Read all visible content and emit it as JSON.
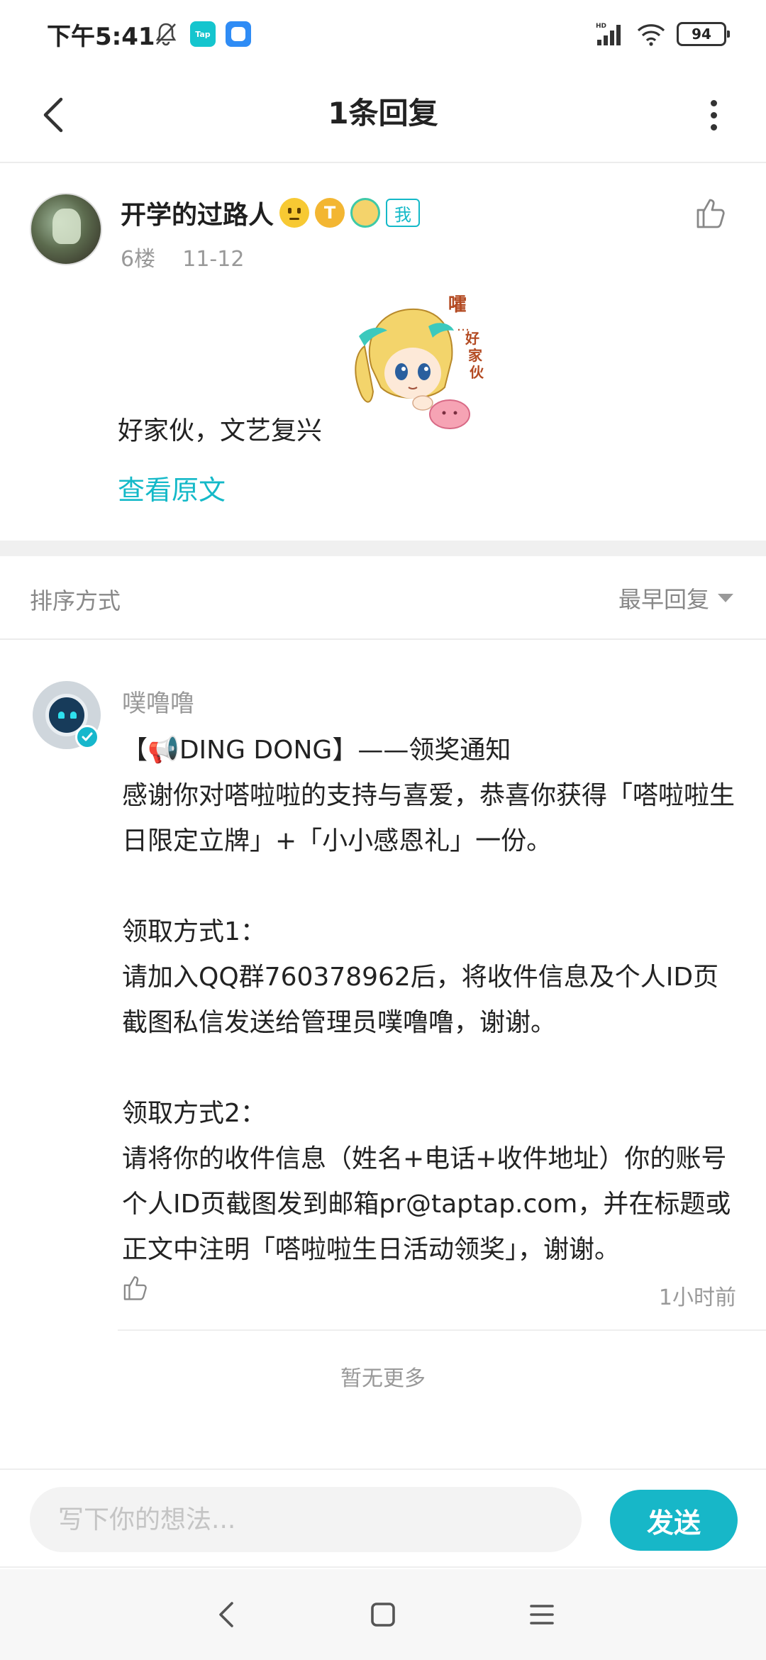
{
  "status_bar": {
    "time": "下午5:41",
    "battery": "94",
    "tap_app_label": "Tap"
  },
  "header": {
    "title": "1条回复"
  },
  "post": {
    "author": "开学的过路人",
    "me_badge": "我",
    "floor": "6楼",
    "date": "11-12",
    "text": "好家伙，文艺复兴",
    "view_original": "查看原文"
  },
  "sort": {
    "label": "排序方式",
    "value": "最早回复"
  },
  "reply": {
    "author": "噗噜噜",
    "body_title": "【📢DING DONG】——领奖通知",
    "body": "感谢你对嗒啦啦的支持与喜爱，恭喜你获得「嗒啦啦生日限定立牌」+「小小感恩礼」一份。\n\n领取方式1：\n请加入QQ群760378962后，将收件信息及个人ID页截图私信发送给管理员噗噜噜，谢谢。\n\n领取方式2：\n请将你的收件信息（姓名+电话+收件地址）你的账号个人ID页截图发到邮箱pr@taptap.com，并在标题或正文中注明「嗒啦啦生日活动领奖」，谢谢。",
    "time": "1小时前"
  },
  "list_end": "暂无更多",
  "composer": {
    "placeholder": "写下你的想法...",
    "send": "发送"
  },
  "colors": {
    "accent": "#17b7c8",
    "muted_text": "#999999"
  },
  "icons": {
    "header_left": "back-arrow-icon",
    "header_right": "more-vertical-icon",
    "like": "thumbs-up-icon",
    "nav": [
      "nav-back-icon",
      "nav-home-icon",
      "nav-menu-icon"
    ]
  }
}
